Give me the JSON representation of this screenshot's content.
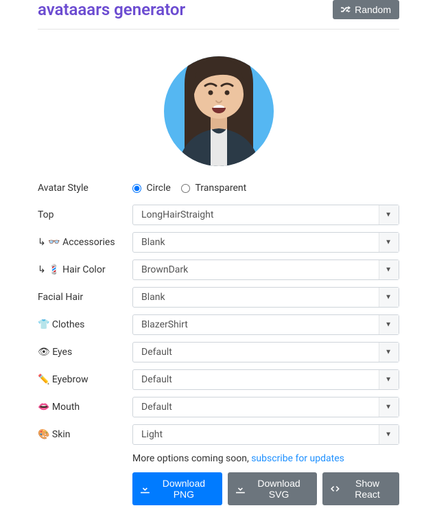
{
  "header": {
    "title": "avataaars generator",
    "random_label": "Random"
  },
  "form": {
    "avatar_style": {
      "label": "Avatar Style",
      "options": {
        "circle": "Circle",
        "transparent": "Transparent"
      },
      "selected": "circle"
    },
    "fields": [
      {
        "key": "top",
        "label": "Top",
        "value": "LongHairStraight",
        "icon": ""
      },
      {
        "key": "accessories",
        "label": "↳ 👓 Accessories",
        "value": "Blank",
        "icon": ""
      },
      {
        "key": "haircolor",
        "label": "↳ 💈 Hair Color",
        "value": "BrownDark",
        "icon": ""
      },
      {
        "key": "facialhair",
        "label": "Facial Hair",
        "value": "Blank",
        "icon": ""
      },
      {
        "key": "clothes",
        "label": "👕 Clothes",
        "value": "BlazerShirt",
        "icon": ""
      },
      {
        "key": "eyes",
        "label": "👁 Eyes",
        "value": "Default",
        "icon": ""
      },
      {
        "key": "eyebrow",
        "label": "✏️ Eyebrow",
        "value": "Default",
        "icon": ""
      },
      {
        "key": "mouth",
        "label": "👄 Mouth",
        "value": "Default",
        "icon": ""
      },
      {
        "key": "skin",
        "label": "🎨 Skin",
        "value": "Light",
        "icon": ""
      }
    ]
  },
  "footer": {
    "more_text": "More options coming soon, ",
    "subscribe_text": "subscribe for updates",
    "download_png": "Download PNG",
    "download_svg": "Download SVG",
    "show_react": "Show React"
  }
}
